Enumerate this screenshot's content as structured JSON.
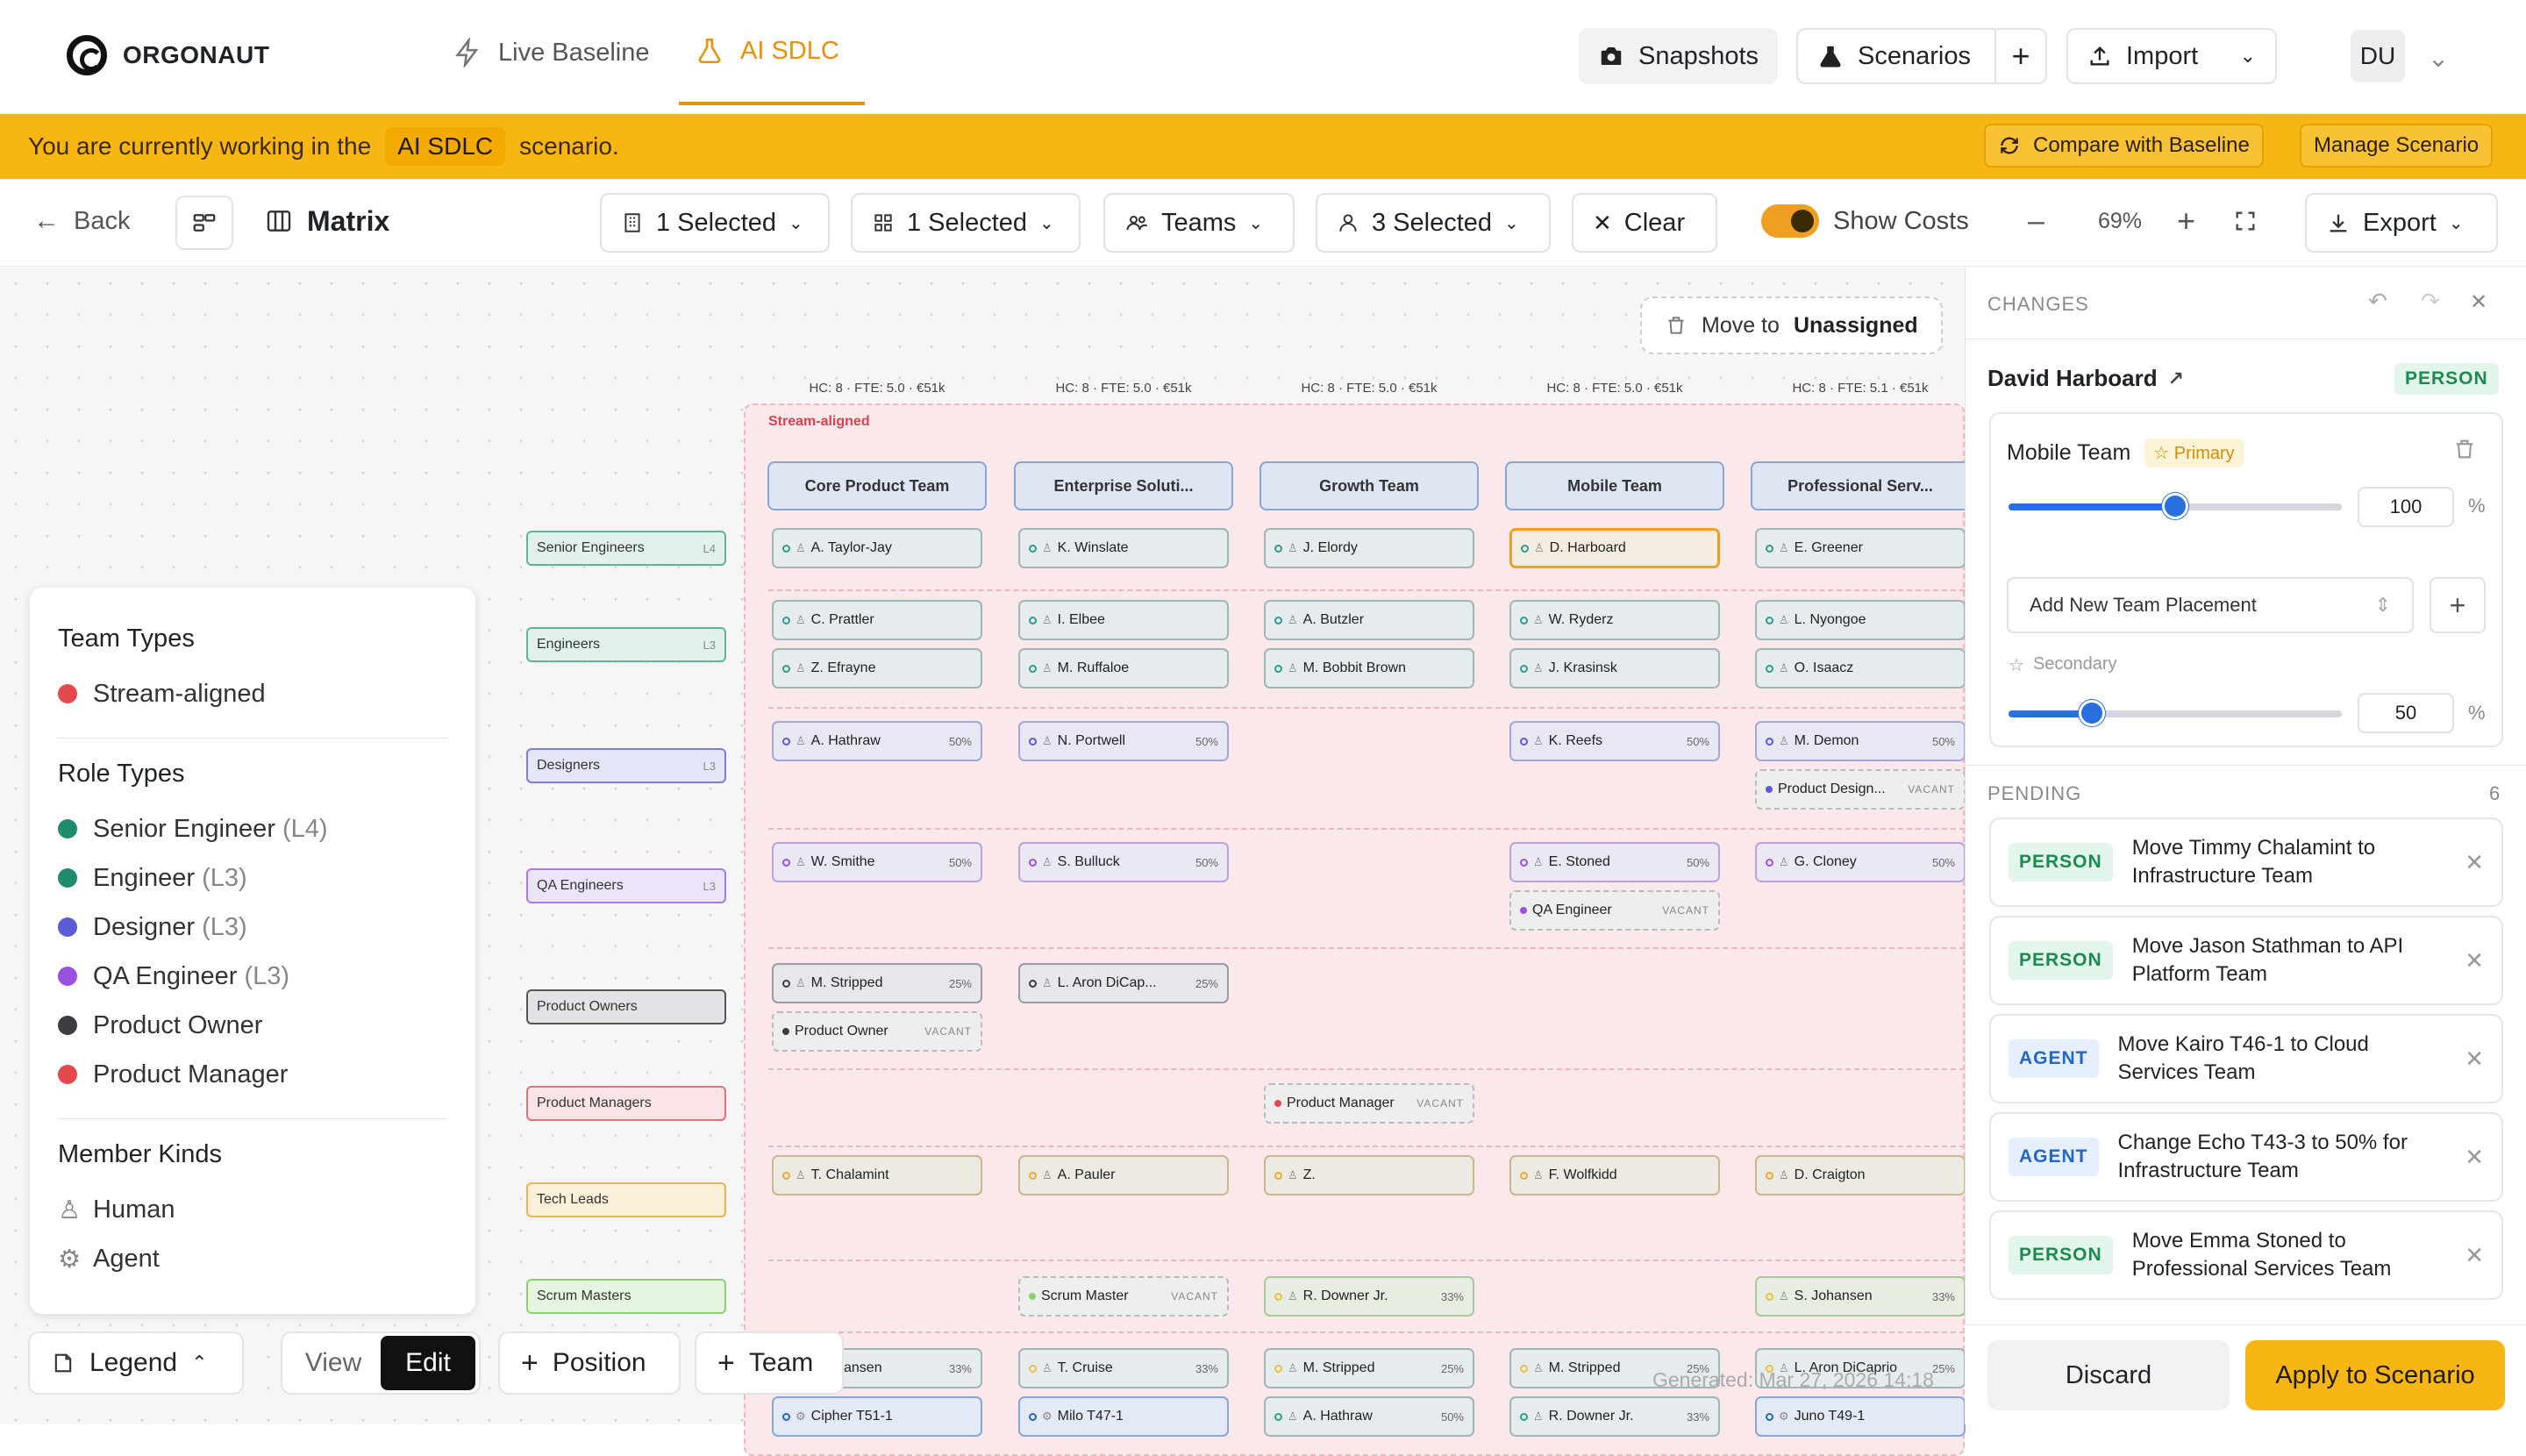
{
  "app": {
    "brand": "ORGONAUT"
  },
  "nav": {
    "tabs": [
      {
        "label": "Live Baseline"
      },
      {
        "label": "AI SDLC"
      }
    ]
  },
  "topbar": {
    "snapshots": "Snapshots",
    "scenarios": "Scenarios",
    "import": "Import",
    "user_initials": "DU"
  },
  "banner": {
    "prefix": "You are currently working in the",
    "scenario": "AI SDLC",
    "suffix": "scenario.",
    "compare": "Compare with Baseline",
    "manage": "Manage Scenario"
  },
  "toolbar": {
    "back": "Back",
    "view_name": "Matrix",
    "filter1": "1 Selected",
    "filter2": "1 Selected",
    "teams": "Teams",
    "filter3": "3 Selected",
    "clear": "Clear",
    "show_costs": "Show Costs",
    "zoom": "69%",
    "export": "Export"
  },
  "canvas": {
    "move_label": "Move to",
    "move_target": "Unassigned",
    "group_label": "Stream-aligned",
    "generated": "Generated: Mar 27, 2026 14:18"
  },
  "columns": [
    {
      "hc": "HC: 8 · FTE: 5.0 · €51k",
      "name": "Core Product Team"
    },
    {
      "hc": "HC: 8 · FTE: 5.0 · €51k",
      "name": "Enterprise Soluti..."
    },
    {
      "hc": "HC: 8 · FTE: 5.0 · €51k",
      "name": "Growth Team"
    },
    {
      "hc": "HC: 8 · FTE: 5.0 · €51k",
      "name": "Mobile Team"
    },
    {
      "hc": "HC: 8 · FTE: 5.1 · €51k",
      "name": "Professional Serv..."
    }
  ],
  "roles": [
    {
      "name": "Senior Engineers",
      "level": "L4"
    },
    {
      "name": "Engineers",
      "level": "L3"
    },
    {
      "name": "Designers",
      "level": "L3"
    },
    {
      "name": "QA Engineers",
      "level": "L3"
    },
    {
      "name": "Product Owners",
      "level": ""
    },
    {
      "name": "Product Managers",
      "level": ""
    },
    {
      "name": "Tech Leads",
      "level": ""
    },
    {
      "name": "Scrum Masters",
      "level": ""
    }
  ],
  "cards": {
    "c0": "A. Taylor-Jay",
    "c1": "K. Winslate",
    "c2": "J. Elordy",
    "c3": "D. Harboard",
    "c4": "E. Greener",
    "c5": "C. Prattler",
    "c6": "I. Elbee",
    "c7": "A. Butzler",
    "c8": "W. Ryderz",
    "c9": "L. Nyongoe",
    "c10": "Z. Efrayne",
    "c11": "M. Ruffaloe",
    "c12": "M. Bobbit Brown",
    "c13": "J. Krasinsk",
    "c14": "O. Isaacz",
    "c15": "A. Hathraw",
    "c16": "N. Portwell",
    "c17": "K. Reefs",
    "c18": "M. Demon",
    "c19": "Product Design...",
    "c20": "W. Smithe",
    "c21": "S. Bulluck",
    "c22": "E. Stoned",
    "c23": "G. Cloney",
    "c24": "QA Engineer",
    "c25": "M. Stripped",
    "c26": "L. Aron DiCap...",
    "c27": "Product Owner",
    "c28": "Product Manager",
    "c29": "T. Chalamint",
    "c30": "A. Pauler",
    "c31": "Z.",
    "c32": "F. Wolfkidd",
    "c33": "D. Craigton",
    "c34": "Scrum Master",
    "c35": "R. Downer Jr.",
    "c36": "S. Johansen",
    "c37": "ansen",
    "c38": "T. Cruise",
    "c39": "M. Stripped",
    "c40": "M. Stripped",
    "c41": "L. Aron DiCaprio",
    "c42": "Cipher T51-1",
    "c43": "Milo T47-1",
    "c44": "A. Hathraw",
    "c45": "R. Downer Jr.",
    "c46": "Juno T49-1",
    "vacant": "VACANT",
    "p50": "50%",
    "p25": "25%",
    "p33": "33%"
  },
  "legend": {
    "team_types_title": "Team Types",
    "team_types": [
      {
        "label": "Stream-aligned",
        "color": "#e5484d"
      }
    ],
    "role_types_title": "Role Types",
    "role_types": [
      {
        "label": "Senior Engineer",
        "level": "(L4)",
        "color": "#1f8a6e"
      },
      {
        "label": "Engineer",
        "level": "(L3)",
        "color": "#1f8a6e"
      },
      {
        "label": "Designer",
        "level": "(L3)",
        "color": "#5b5bd6"
      },
      {
        "label": "QA Engineer",
        "level": "(L3)",
        "color": "#9b51e0"
      },
      {
        "label": "Product Owner",
        "level": "",
        "color": "#3a3d42"
      },
      {
        "label": "Product Manager",
        "level": "",
        "color": "#e5484d"
      }
    ],
    "member_kinds_title": "Member Kinds",
    "human": "Human",
    "agent": "Agent"
  },
  "bottombar": {
    "legend": "Legend",
    "view": "View",
    "edit": "Edit",
    "position": "Position",
    "team": "Team"
  },
  "panel": {
    "changes": "CHANGES",
    "person": "David Harboard",
    "person_badge": "PERSON",
    "primary_team": "Mobile Team",
    "primary_label": "Primary",
    "primary_value": "100",
    "primary_pct": 1.0,
    "add_placeholder": "Add New Team Placement",
    "secondary_label": "Secondary",
    "secondary_value": "50",
    "secondary_pct": 0.5,
    "pct_sign": "%",
    "pending_title": "PENDING",
    "pending_count": "6",
    "pending": [
      {
        "kind": "PERSON",
        "text": "Move Timmy Chalamint to Infrastructure Team"
      },
      {
        "kind": "PERSON",
        "text": "Move Jason Stathman to API Platform Team"
      },
      {
        "kind": "AGENT",
        "text": "Move Kairo T46-1 to Cloud Services Team"
      },
      {
        "kind": "AGENT",
        "text": "Change Echo T43-3 to 50% for Infrastructure Team"
      },
      {
        "kind": "PERSON",
        "text": "Move Emma Stoned to Professional Services Team"
      }
    ],
    "discard": "Discard",
    "apply": "Apply to Scenario"
  }
}
